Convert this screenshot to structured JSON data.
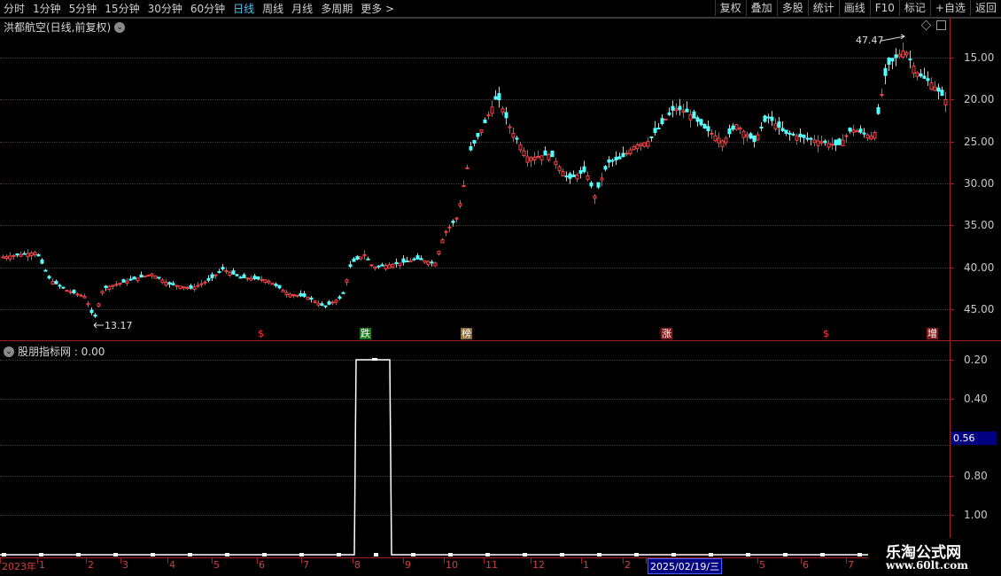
{
  "toolbar": {
    "periods": [
      "分时",
      "1分钟",
      "5分钟",
      "15分钟",
      "30分钟",
      "60分钟",
      "日线",
      "周线",
      "月线",
      "多周期",
      "更多 >"
    ],
    "active_period": "日线",
    "buttons": [
      "复权",
      "叠加",
      "多股",
      "统计",
      "画线",
      "F10",
      "标记",
      "+自选",
      "返回"
    ]
  },
  "main_chart": {
    "title": "洪都航空(日线,前复权)",
    "max_label": "47.47",
    "min_label": "13.17",
    "y_ticks": [
      "45.00",
      "40.00",
      "35.00",
      "30.00",
      "25.00",
      "20.00",
      "15.00"
    ]
  },
  "markers": [
    {
      "text": "$",
      "kind": "s"
    },
    {
      "text": "跌",
      "kind": "die"
    },
    {
      "text": "榜",
      "kind": "bang"
    },
    {
      "text": "涨",
      "kind": "zhang"
    },
    {
      "text": "$",
      "kind": "s"
    },
    {
      "text": "增",
      "kind": "zeng"
    }
  ],
  "indicator": {
    "title": "股朋指标网 : 0.00",
    "y_ticks": [
      "1.00",
      "0.80",
      "0.40",
      "0.20"
    ],
    "current_value": "0.56"
  },
  "timeline": {
    "labels": [
      "2023年",
      "1",
      "2",
      "3",
      "4",
      "5",
      "6",
      "7",
      "8",
      "9",
      "10",
      "11",
      "12",
      "1",
      "2",
      "2025/02/19/三",
      "5",
      "6",
      "7"
    ],
    "highlight": "2025/02/19/三"
  },
  "watermark": {
    "title": "乐淘公式网",
    "url": "www.60lt.com"
  },
  "colors": {
    "up": "#ff4040",
    "down": "#54ffff",
    "axis": "#a32020",
    "accent": "#000080"
  },
  "chart_data": [
    {
      "type": "candlestick",
      "title": "洪都航空(日线,前复权)",
      "ylim": [
        12,
        48.5
      ],
      "y_ticks": [
        15,
        20,
        25,
        30,
        35,
        40,
        45
      ],
      "annotations": [
        {
          "label": "47.47",
          "value": 47.47
        },
        {
          "label": "13.17",
          "value": 13.17
        }
      ],
      "x_range": [
        "2023-12",
        "2025-07"
      ],
      "close_path": [
        [
          0,
          21.2
        ],
        [
          20,
          21.5
        ],
        [
          40,
          21.8
        ],
        [
          55,
          18.5
        ],
        [
          75,
          17.2
        ],
        [
          95,
          16.5
        ],
        [
          105,
          13.8
        ],
        [
          115,
          17.5
        ],
        [
          140,
          18.3
        ],
        [
          170,
          19.2
        ],
        [
          190,
          18.0
        ],
        [
          215,
          17.5
        ],
        [
          235,
          18.5
        ],
        [
          250,
          19.8
        ],
        [
          270,
          18.8
        ],
        [
          300,
          18.5
        ],
        [
          325,
          16.8
        ],
        [
          345,
          16.5
        ],
        [
          365,
          15.3
        ],
        [
          385,
          16.5
        ],
        [
          395,
          20.5
        ],
        [
          410,
          21.5
        ],
        [
          420,
          20.0
        ],
        [
          450,
          20.5
        ],
        [
          470,
          21.0
        ],
        [
          490,
          20.5
        ],
        [
          500,
          24.0
        ],
        [
          515,
          26.0
        ],
        [
          530,
          34.0
        ],
        [
          545,
          37.0
        ],
        [
          560,
          40.5
        ],
        [
          575,
          36.5
        ],
        [
          595,
          33.0
        ],
        [
          620,
          33.5
        ],
        [
          640,
          30.5
        ],
        [
          660,
          31.5
        ],
        [
          670,
          28.5
        ],
        [
          685,
          32.5
        ],
        [
          700,
          33.0
        ],
        [
          715,
          34.5
        ],
        [
          730,
          35.0
        ],
        [
          745,
          37.0
        ],
        [
          760,
          39.0
        ],
        [
          775,
          38.5
        ],
        [
          795,
          36.5
        ],
        [
          815,
          35.0
        ],
        [
          830,
          37.0
        ],
        [
          850,
          35.0
        ],
        [
          865,
          38.0
        ],
        [
          885,
          36.0
        ],
        [
          905,
          35.5
        ],
        [
          925,
          35.0
        ],
        [
          945,
          34.5
        ],
        [
          960,
          36.5
        ],
        [
          985,
          35.5
        ],
        [
          1000,
          44.0
        ],
        [
          1020,
          46.0
        ],
        [
          1035,
          43.0
        ],
        [
          1050,
          42.0
        ],
        [
          1066,
          40.0
        ]
      ]
    },
    {
      "type": "line",
      "title": "股朋指标网",
      "ylim": [
        0,
        1.05
      ],
      "y_ticks": [
        0.2,
        0.4,
        0.8,
        1.0
      ],
      "x": [
        0,
        400,
        402,
        440,
        442,
        980
      ],
      "y": [
        0,
        0,
        1,
        1,
        0,
        0
      ]
    }
  ]
}
